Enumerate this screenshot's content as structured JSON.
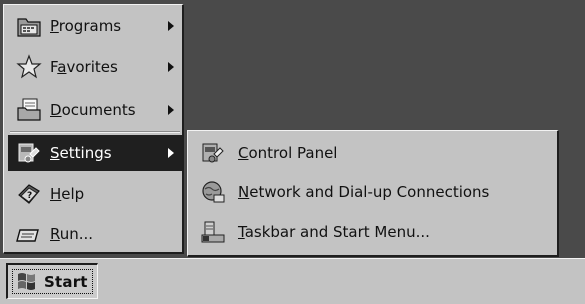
{
  "start_menu": {
    "items": [
      {
        "id": "programs",
        "icon": "programs-folder-icon",
        "pre": "",
        "mn": "P",
        "post": "rograms",
        "submenu": true
      },
      {
        "id": "favorites",
        "icon": "favorites-star-icon",
        "pre": "F",
        "mn": "a",
        "post": "vorites",
        "submenu": true
      },
      {
        "id": "documents",
        "icon": "documents-folder-icon",
        "pre": "",
        "mn": "D",
        "post": "ocuments",
        "submenu": true
      },
      {
        "id": "settings",
        "icon": "settings-icon",
        "pre": "",
        "mn": "S",
        "post": "ettings",
        "submenu": true,
        "active": true
      },
      {
        "id": "help",
        "icon": "help-book-icon",
        "pre": "",
        "mn": "H",
        "post": "elp",
        "submenu": false
      },
      {
        "id": "run",
        "icon": "run-icon",
        "pre": "",
        "mn": "R",
        "post": "un...",
        "submenu": false
      }
    ]
  },
  "settings_submenu": {
    "items": [
      {
        "id": "control-panel",
        "icon": "control-panel-icon",
        "pre": "",
        "mn": "C",
        "post": "ontrol Panel"
      },
      {
        "id": "network",
        "icon": "network-globe-icon",
        "pre": "",
        "mn": "N",
        "post": "etwork and Dial-up Connections"
      },
      {
        "id": "taskbar",
        "icon": "taskbar-icon",
        "pre": "",
        "mn": "T",
        "post": "askbar and Start Menu..."
      }
    ]
  },
  "taskbar": {
    "start_label": "Start"
  },
  "colors": {
    "menu_bg": "#c3c3c3",
    "highlight": "#1f1f1f",
    "desktop": "#4a4a4a"
  }
}
